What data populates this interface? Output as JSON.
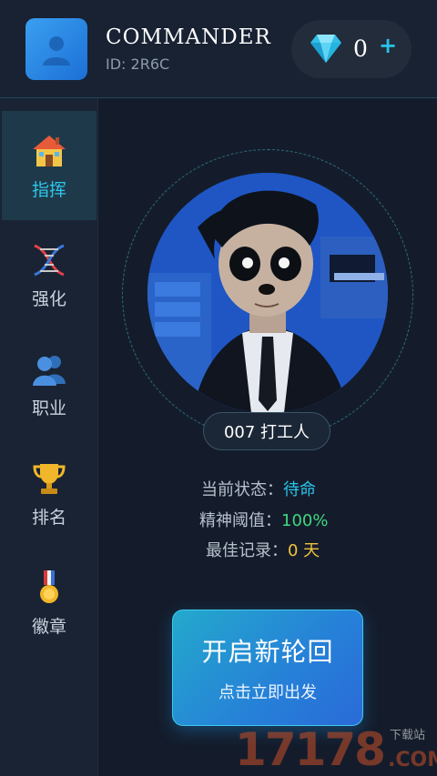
{
  "header": {
    "user_name": "COMMANDER",
    "user_id": "ID: 2R6C",
    "gem_count": "0",
    "gem_plus": "+"
  },
  "sidebar": {
    "items": [
      {
        "label": "指挥",
        "icon": "house-icon",
        "active": true
      },
      {
        "label": "强化",
        "icon": "dna-icon",
        "active": false
      },
      {
        "label": "职业",
        "icon": "people-icon",
        "active": false
      },
      {
        "label": "排名",
        "icon": "trophy-icon",
        "active": false
      },
      {
        "label": "徽章",
        "icon": "medal-icon",
        "active": false
      }
    ]
  },
  "main": {
    "role_name": "007 打工人",
    "stats": [
      {
        "label": "当前状态：",
        "value": "待命"
      },
      {
        "label": "精神阈值：",
        "value": "100%"
      },
      {
        "label": "最佳记录：",
        "value": "0 天"
      }
    ],
    "start_button": {
      "title": "开启新轮回",
      "subtitle": "点击立即出发"
    }
  },
  "watermark": {
    "main": "17178",
    "suffix": ".COM",
    "label": "下载站"
  },
  "colors": {
    "accent": "#2fc6ec",
    "background": "#141c2b",
    "status_value": "#29c5ea",
    "percent_value": "#3fd680",
    "record_value": "#f2c23b"
  }
}
